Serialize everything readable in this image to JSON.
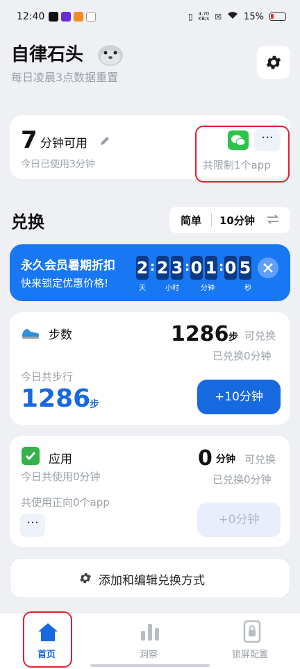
{
  "status_bar": {
    "time": "12:40",
    "speed_value": "4.70",
    "speed_unit": "KB/s",
    "battery": "15%"
  },
  "header": {
    "title": "自律石头",
    "subtitle": "每日凌晨3点数据重置",
    "settings_icon": "gear-icon"
  },
  "usage": {
    "available_minutes": "7",
    "available_label": "分钟可用",
    "used_today": "今日已使用3分钟",
    "limit_text": "共限制1个app",
    "more_label": "···"
  },
  "exchange": {
    "title": "兑换",
    "mode_simple": "简单",
    "mode_minutes": "10分钟"
  },
  "promo": {
    "title": "永久会员暑期折扣",
    "subtitle": "快来锁定优惠价格!",
    "days": "2",
    "hours": [
      "2",
      "3"
    ],
    "minutes": [
      "0",
      "1"
    ],
    "seconds": [
      "0",
      "5"
    ],
    "label_day": "天",
    "label_hour": "小时",
    "label_minute": "分钟",
    "label_second": "秒"
  },
  "steps": {
    "label": "步数",
    "count": "1286",
    "count_unit": "步",
    "exchangeable": "可兑换",
    "redeemed": "已兑换0分钟",
    "today_label": "今日共步行",
    "today_count": "1286",
    "today_unit": "步",
    "button": "+10分钟"
  },
  "apps": {
    "label": "应用",
    "minutes": "0",
    "minutes_unit": "分钟",
    "exchangeable": "可兑换",
    "today": "今日共使用0分钟",
    "redeemed": "已兑换0分钟",
    "positive": "共使用正向0个app",
    "more_label": "···",
    "button": "+0分钟"
  },
  "add_edit": {
    "label": "添加和编辑兑换方式"
  },
  "nav": {
    "home": "首页",
    "insight": "洞察",
    "lock": "锁屏配置"
  },
  "colors": {
    "accent": "#1769e0",
    "promo_bg": "#1877f2",
    "highlight_red": "#e0202a",
    "wechat_green": "#2bc44a"
  }
}
